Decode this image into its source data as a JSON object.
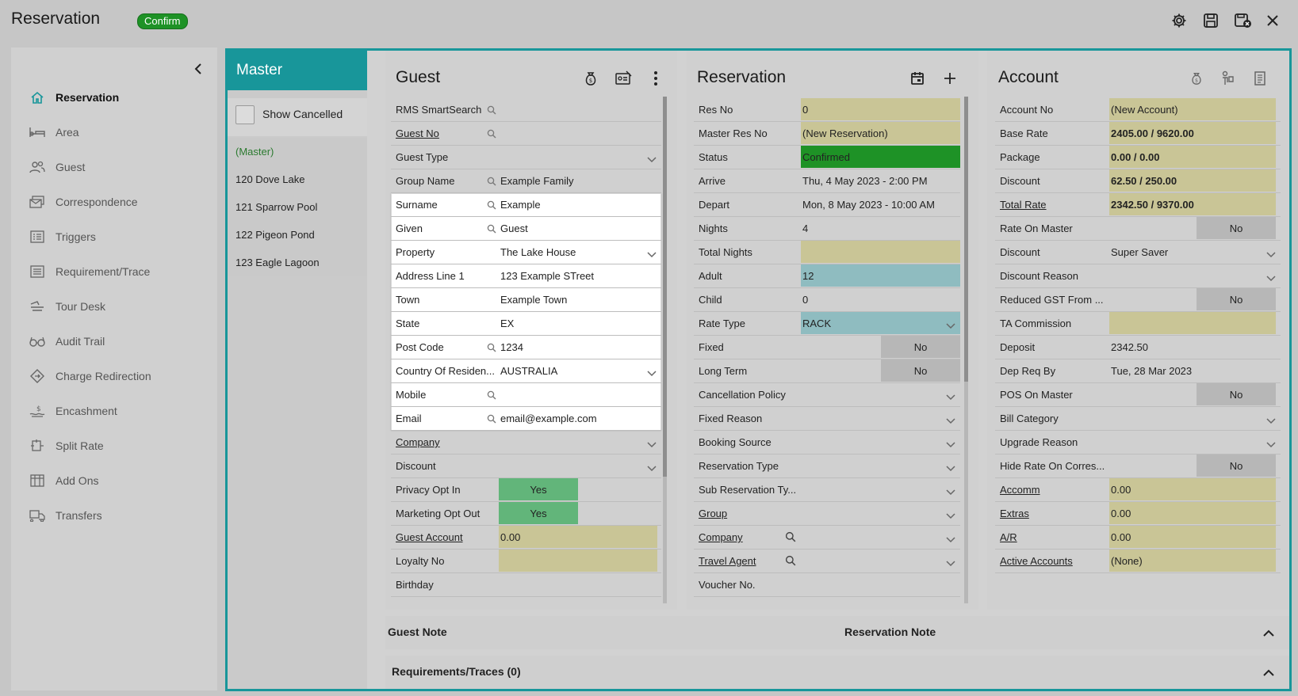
{
  "header": {
    "title": "Reservation",
    "badge": "Confirm",
    "icons": [
      "gear-icon",
      "save-icon",
      "save-close-icon",
      "close-icon"
    ]
  },
  "nav": {
    "items": [
      {
        "label": "Reservation",
        "icon": "home-icon",
        "active": true
      },
      {
        "label": "Area",
        "icon": "bed-icon"
      },
      {
        "label": "Guest",
        "icon": "people-icon"
      },
      {
        "label": "Correspondence",
        "icon": "mail-icon"
      },
      {
        "label": "Triggers",
        "icon": "list-icon"
      },
      {
        "label": "Requirement/Trace",
        "icon": "checklist-icon"
      },
      {
        "label": "Tour Desk",
        "icon": "ticket-icon"
      },
      {
        "label": "Audit Trail",
        "icon": "glasses-icon"
      },
      {
        "label": "Charge Redirection",
        "icon": "redirect-icon"
      },
      {
        "label": "Encashment",
        "icon": "cash-icon"
      },
      {
        "label": "Split Rate",
        "icon": "split-icon"
      },
      {
        "label": "Add Ons",
        "icon": "grid-icon"
      },
      {
        "label": "Transfers",
        "icon": "transfer-icon"
      }
    ]
  },
  "master": {
    "title": "Master",
    "show_cancelled": "Show Cancelled",
    "items": [
      "(Master)",
      "120 Dove Lake",
      "121 Sparrow Pool",
      "122 Pigeon Pond",
      "123 Eagle Lagoon"
    ]
  },
  "guest": {
    "title": "Guest",
    "rows": [
      {
        "label": "RMS SmartSearch",
        "value": ""
      },
      {
        "label": "Guest No",
        "value": ""
      },
      {
        "label": "Guest Type",
        "value": ""
      },
      {
        "label": "Group Name",
        "value": "Example Family"
      },
      {
        "label": "Surname",
        "value": "Example"
      },
      {
        "label": "Given",
        "value": "Guest"
      },
      {
        "label": "Property",
        "value": "The Lake House"
      },
      {
        "label": "Address Line 1",
        "value": "123 Example STreet"
      },
      {
        "label": "Town",
        "value": "Example Town"
      },
      {
        "label": "State",
        "value": "EX"
      },
      {
        "label": "Post Code",
        "value": "1234"
      },
      {
        "label": "Country Of Residen...",
        "value": "AUSTRALIA"
      },
      {
        "label": "Mobile",
        "value": ""
      },
      {
        "label": "Email",
        "value": "email@example.com"
      },
      {
        "label": "Company",
        "value": ""
      },
      {
        "label": "Discount",
        "value": ""
      },
      {
        "label": "Privacy Opt In",
        "value": "Yes"
      },
      {
        "label": "Marketing Opt Out",
        "value": "Yes"
      },
      {
        "label": "Guest Account",
        "value": "0.00"
      },
      {
        "label": "Loyalty No",
        "value": ""
      },
      {
        "label": "Birthday",
        "value": ""
      }
    ]
  },
  "reservation": {
    "title": "Reservation",
    "rows": [
      {
        "label": "Res No",
        "value": "0"
      },
      {
        "label": "Master Res No",
        "value": "(New Reservation)"
      },
      {
        "label": "Status",
        "value": "Confirmed"
      },
      {
        "label": "Arrive",
        "value": "Thu, 4 May 2023 - 2:00 PM"
      },
      {
        "label": "Depart",
        "value": "Mon, 8 May 2023 - 10:00 AM"
      },
      {
        "label": "Nights",
        "value": "4"
      },
      {
        "label": "Total Nights",
        "value": ""
      },
      {
        "label": "Adult",
        "value": "12"
      },
      {
        "label": "Child",
        "value": "0"
      },
      {
        "label": "Rate Type",
        "value": "RACK"
      },
      {
        "label": "Fixed",
        "value": "No"
      },
      {
        "label": "Long Term",
        "value": "No"
      },
      {
        "label": "Cancellation Policy",
        "value": ""
      },
      {
        "label": "Fixed Reason",
        "value": ""
      },
      {
        "label": "Booking Source",
        "value": ""
      },
      {
        "label": "Reservation Type",
        "value": ""
      },
      {
        "label": "Sub Reservation Ty...",
        "value": ""
      },
      {
        "label": "Group",
        "value": ""
      },
      {
        "label": "Company",
        "value": ""
      },
      {
        "label": "Travel Agent",
        "value": ""
      },
      {
        "label": "Voucher No.",
        "value": ""
      }
    ]
  },
  "account": {
    "title": "Account",
    "rows": [
      {
        "label": "Account No",
        "value": "(New Account)"
      },
      {
        "label": "Base Rate",
        "value": "2405.00 / 9620.00"
      },
      {
        "label": "Package",
        "value": "0.00 / 0.00"
      },
      {
        "label": "Discount",
        "value": "62.50 / 250.00"
      },
      {
        "label": "Total Rate",
        "value": "2342.50 / 9370.00"
      },
      {
        "label": "Rate On Master",
        "value": "No"
      },
      {
        "label": "Discount",
        "value": "Super Saver"
      },
      {
        "label": "Discount Reason",
        "value": ""
      },
      {
        "label": "Reduced GST From ...",
        "value": "No"
      },
      {
        "label": "TA Commission",
        "value": ""
      },
      {
        "label": "Deposit",
        "value": "2342.50"
      },
      {
        "label": "Dep Req By",
        "value": "Tue, 28 Mar 2023"
      },
      {
        "label": "POS On Master",
        "value": "No"
      },
      {
        "label": "Bill Category",
        "value": ""
      },
      {
        "label": "Upgrade Reason",
        "value": ""
      },
      {
        "label": "Hide Rate On Corres...",
        "value": "No"
      },
      {
        "label": "Accomm",
        "value": "0.00"
      },
      {
        "label": "Extras",
        "value": "0.00"
      },
      {
        "label": "A/R",
        "value": "0.00"
      },
      {
        "label": "Active Accounts",
        "value": "(None)"
      }
    ]
  },
  "bottom": {
    "guest_note": "Guest Note",
    "reservation_note": "Reservation Note",
    "requirements": "Requirements/Traces (0)"
  },
  "colors": {
    "accent": "#18969a",
    "confirm": "#1e9226",
    "khaki": "#c9c596",
    "teal": "#8fbcc0",
    "mint": "#62b57a"
  }
}
